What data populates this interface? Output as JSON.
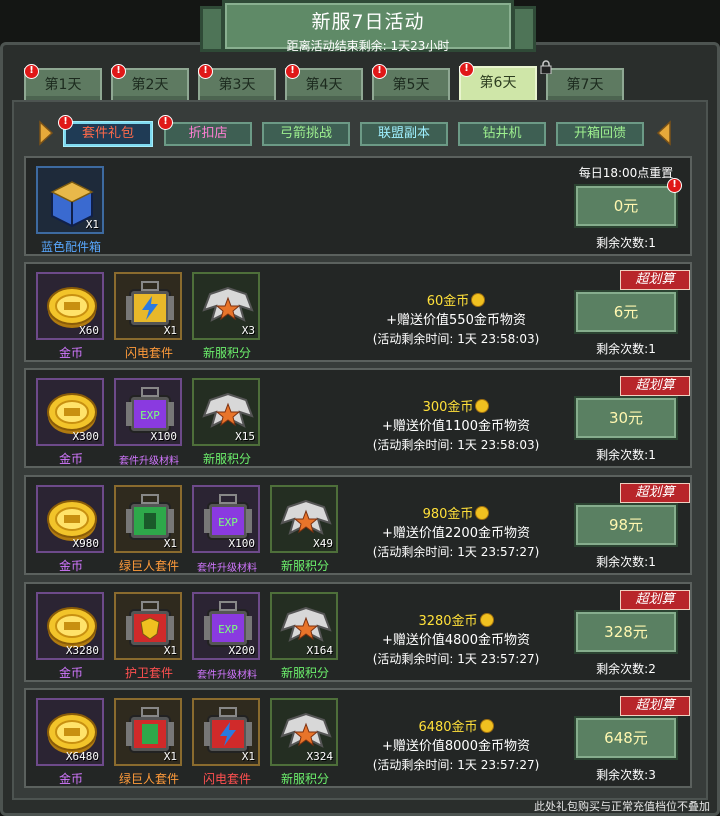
{
  "header": {
    "title": "新服7日活动",
    "subtitle": "距离活动结束剩余: 1天23小时"
  },
  "days": [
    {
      "label": "第1天",
      "badge": "!"
    },
    {
      "label": "第2天",
      "badge": "!"
    },
    {
      "label": "第3天",
      "badge": "!"
    },
    {
      "label": "第4天",
      "badge": "!"
    },
    {
      "label": "第5天",
      "badge": "!"
    },
    {
      "label": "第6天",
      "badge": "!",
      "active": true
    },
    {
      "label": "第7天",
      "locked": true
    }
  ],
  "subtabs": [
    {
      "label": "套件礼包",
      "active": true,
      "badge": "!"
    },
    {
      "label": "折扣店",
      "badge": "!"
    },
    {
      "label": "弓箭挑战"
    },
    {
      "label": "联盟副本"
    },
    {
      "label": "钻井机"
    },
    {
      "label": "开箱回馈"
    }
  ],
  "free_row": {
    "item_qty": "X1",
    "item_label": "蓝色配件箱",
    "reset_text": "每日18:00点重置",
    "price": "0元",
    "remaining": "剩余次数:1",
    "badge": "!"
  },
  "deal_label": "超划算",
  "rows": [
    {
      "items": [
        {
          "qty": "X60",
          "label": "金币"
        },
        {
          "qty": "X1",
          "label": "闪电套件"
        },
        {
          "qty": "X3",
          "label": "新服积分"
        }
      ],
      "gold": "60金币",
      "bonus": "+赠送价值550金币物资",
      "time": "(活动剩余时间: 1天 23:58:03)",
      "price": "6元",
      "remaining": "剩余次数:1"
    },
    {
      "items": [
        {
          "qty": "X300",
          "label": "金币"
        },
        {
          "qty": "X100",
          "label": "套件升级材料"
        },
        {
          "qty": "X15",
          "label": "新服积分"
        }
      ],
      "gold": "300金币",
      "bonus": "+赠送价值1100金币物资",
      "time": "(活动剩余时间: 1天 23:58:03)",
      "price": "30元",
      "remaining": "剩余次数:1"
    },
    {
      "items": [
        {
          "qty": "X980",
          "label": "金币"
        },
        {
          "qty": "X1",
          "label": "绿巨人套件"
        },
        {
          "qty": "X100",
          "label": "套件升级材料"
        },
        {
          "qty": "X49",
          "label": "新服积分"
        }
      ],
      "gold": "980金币",
      "bonus": "+赠送价值2200金币物资",
      "time": "(活动剩余时间: 1天 23:57:27)",
      "price": "98元",
      "remaining": "剩余次数:1"
    },
    {
      "items": [
        {
          "qty": "X3280",
          "label": "金币"
        },
        {
          "qty": "X1",
          "label": "护卫套件"
        },
        {
          "qty": "X200",
          "label": "套件升级材料"
        },
        {
          "qty": "X164",
          "label": "新服积分"
        }
      ],
      "gold": "3280金币",
      "bonus": "+赠送价值4800金币物资",
      "time": "(活动剩余时间: 1天 23:57:27)",
      "price": "328元",
      "remaining": "剩余次数:2"
    },
    {
      "items": [
        {
          "qty": "X6480",
          "label": "金币"
        },
        {
          "qty": "X1",
          "label": "绿巨人套件"
        },
        {
          "qty": "X1",
          "label": "闪电套件"
        },
        {
          "qty": "X324",
          "label": "新服积分"
        }
      ],
      "gold": "6480金币",
      "bonus": "+赠送价值8000金币物资",
      "time": "(活动剩余时间: 1天 23:57:27)",
      "price": "648元",
      "remaining": "剩余次数:3"
    }
  ],
  "footnote": "此处礼包购买与正常充值档位不叠加",
  "colors": {
    "accent": "#ffe03a",
    "deal": "#b8252a",
    "button": "#5a8062",
    "active_day": "#cfe6a8"
  }
}
